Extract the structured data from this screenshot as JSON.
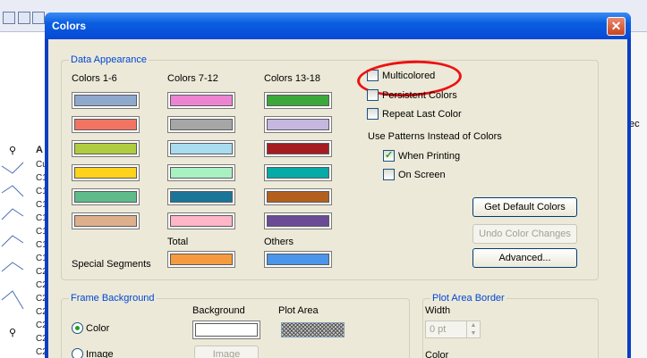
{
  "dialog": {
    "title": "Colors",
    "close_glyph": "✕"
  },
  "data_appearance": {
    "group_title": "Data Appearance",
    "col1_header": "Colors 1-6",
    "col2_header": "Colors 7-12",
    "col3_header": "Colors 13-18",
    "colors_1_6": [
      "#8ea9cc",
      "#f27563",
      "#b0cc3f",
      "#ffd21c",
      "#5fbb8a",
      "#ddb08b"
    ],
    "colors_7_12": [
      "#ec84d2",
      "#a6a6a6",
      "#a9dcee",
      "#aaf1c2",
      "#1a7599",
      "#ffb6c6"
    ],
    "colors_13_18": [
      "#3ca73a",
      "#c5b7e0",
      "#a51b20",
      "#06aaa6",
      "#b3601e",
      "#6b4b96"
    ],
    "total_label": "Total",
    "total_color": "#f59a3e",
    "others_label": "Others",
    "others_color": "#4b95ea",
    "special_segments_label": "Special Segments"
  },
  "options": {
    "multicolored": {
      "label": "Multicolored",
      "checked": false
    },
    "persistent_colors": {
      "label": "Persistent Colors",
      "checked": false
    },
    "repeat_last_color": {
      "label": "Repeat Last Color",
      "checked": false
    },
    "patterns_heading": "Use Patterns Instead of Colors",
    "when_printing": {
      "label": "When Printing",
      "checked": true
    },
    "on_screen": {
      "label": "On Screen",
      "checked": false
    },
    "check_glyph": "✓"
  },
  "buttons": {
    "get_default_colors": "Get Default Colors",
    "undo_color_changes": "Undo Color Changes",
    "advanced": "Advanced..."
  },
  "frame_background": {
    "group_title": "Frame Background",
    "background_label": "Background",
    "plot_area_label": "Plot Area",
    "color_option": "Color",
    "image_option": "Image",
    "image_button": "Image",
    "background_color": "#ffffff"
  },
  "plot_area_border": {
    "group_title": "Plot Area Border",
    "width_label": "Width",
    "width_value": "0 pt",
    "color_label": "Color"
  },
  "background_app": {
    "right_fragment": "ec",
    "list_header": "A",
    "list_rows": [
      "Cu",
      "C1",
      "C1",
      "C1",
      "C1",
      "C1",
      "C1",
      "C1",
      "C2",
      "C2",
      "C2",
      "C2",
      "C2",
      "C2",
      "C2",
      "C3"
    ]
  }
}
